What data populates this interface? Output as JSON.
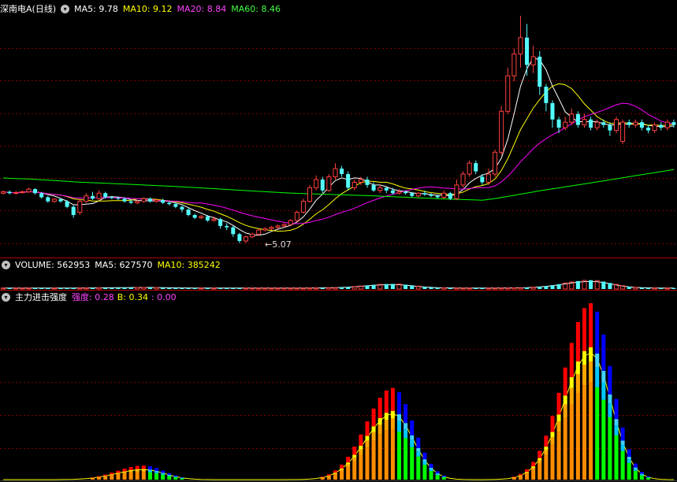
{
  "colors": {
    "up": "#ff4040",
    "down": "#54fcfc",
    "ma5": "#ffffff",
    "ma10": "#ffff00",
    "ma20": "#ff00ff",
    "ma60": "#00ff00",
    "grid": "#7a0000",
    "sep": "#b00000"
  },
  "price_header": {
    "title": "深南电A(日线)",
    "icon": "chevron-down-icon",
    "ma5": "MA5: 9.78",
    "ma10": "MA10: 9.12",
    "ma20": "MA20: 8.84",
    "ma60": "MA60: 8.46"
  },
  "low_marker": "←5.07",
  "volume_header": {
    "icon": "chevron-down-icon",
    "vol": "VOLUME: 562953",
    "ma5": "MA5: 627570",
    "ma10": "MA10: 385242"
  },
  "indicator_header": {
    "icon": "chevron-down-icon",
    "title": "主力进击强度",
    "qd": "强度: 0.28",
    "b": "B: 0.34",
    "z": ": 0.00"
  },
  "chart_data": [
    {
      "type": "candlestick",
      "title": "深南电A(日线)",
      "series": [
        {
          "name": "MA5",
          "value": 9.78
        },
        {
          "name": "MA10",
          "value": 9.12
        },
        {
          "name": "MA20",
          "value": 8.84
        },
        {
          "name": "MA60",
          "value": 8.46
        }
      ],
      "ylim": [
        4.6,
        13.4
      ],
      "min_marker": 5.07,
      "candles": [
        [
          6.9,
          6.95,
          6.85,
          7.0
        ],
        [
          6.95,
          6.9,
          6.85,
          7.0
        ],
        [
          6.9,
          6.92,
          6.85,
          6.98
        ],
        [
          6.92,
          6.95,
          6.88,
          7.0
        ],
        [
          6.95,
          7.05,
          6.9,
          7.1
        ],
        [
          7.05,
          6.9,
          6.85,
          7.08
        ],
        [
          6.9,
          6.75,
          6.7,
          6.95
        ],
        [
          6.75,
          6.6,
          6.55,
          6.8
        ],
        [
          6.6,
          6.68,
          6.55,
          6.72
        ],
        [
          6.68,
          6.6,
          6.55,
          6.7
        ],
        [
          6.6,
          6.4,
          6.35,
          6.65
        ],
        [
          6.4,
          6.1,
          6.0,
          6.45
        ],
        [
          6.2,
          6.6,
          6.1,
          6.7
        ],
        [
          6.6,
          6.8,
          6.55,
          6.9
        ],
        [
          6.8,
          6.7,
          6.65,
          6.95
        ],
        [
          6.7,
          6.9,
          6.65,
          7.0
        ],
        [
          6.9,
          6.75,
          6.7,
          6.95
        ],
        [
          6.75,
          6.72,
          6.68,
          6.8
        ],
        [
          6.72,
          6.7,
          6.65,
          6.78
        ],
        [
          6.7,
          6.6,
          6.55,
          6.75
        ],
        [
          6.6,
          6.55,
          6.5,
          6.65
        ],
        [
          6.55,
          6.6,
          6.5,
          6.65
        ],
        [
          6.6,
          6.7,
          6.55,
          6.75
        ],
        [
          6.7,
          6.6,
          6.55,
          6.75
        ],
        [
          6.6,
          6.65,
          6.55,
          6.7
        ],
        [
          6.65,
          6.55,
          6.5,
          6.7
        ],
        [
          6.55,
          6.5,
          6.45,
          6.6
        ],
        [
          6.5,
          6.4,
          6.35,
          6.55
        ],
        [
          6.4,
          6.3,
          6.2,
          6.45
        ],
        [
          6.3,
          6.1,
          6.05,
          6.35
        ],
        [
          6.1,
          6.0,
          5.95,
          6.15
        ],
        [
          6.0,
          6.05,
          5.95,
          6.1
        ],
        [
          6.05,
          5.9,
          5.85,
          6.1
        ],
        [
          5.9,
          5.95,
          5.85,
          6.05
        ],
        [
          5.95,
          5.7,
          5.6,
          6.0
        ],
        [
          5.7,
          5.65,
          5.55,
          5.8
        ],
        [
          5.65,
          5.4,
          5.3,
          5.7
        ],
        [
          5.4,
          5.15,
          5.07,
          5.45
        ],
        [
          5.15,
          5.3,
          5.07,
          5.35
        ],
        [
          5.3,
          5.4,
          5.25,
          5.45
        ],
        [
          5.4,
          5.55,
          5.35,
          5.6
        ],
        [
          5.55,
          5.6,
          5.5,
          5.65
        ],
        [
          5.6,
          5.65,
          5.55,
          5.7
        ],
        [
          5.65,
          5.7,
          5.6,
          5.75
        ],
        [
          5.7,
          5.75,
          5.65,
          5.8
        ],
        [
          5.75,
          5.9,
          5.7,
          5.95
        ],
        [
          5.9,
          6.2,
          5.85,
          6.25
        ],
        [
          6.2,
          6.6,
          6.15,
          6.7
        ],
        [
          6.6,
          7.1,
          6.55,
          7.2
        ],
        [
          7.1,
          7.4,
          7.0,
          7.55
        ],
        [
          7.4,
          7.0,
          6.9,
          7.5
        ],
        [
          7.0,
          7.5,
          6.95,
          7.6
        ],
        [
          7.5,
          7.8,
          7.4,
          8.0
        ],
        [
          7.8,
          7.6,
          7.5,
          7.9
        ],
        [
          7.6,
          7.1,
          7.0,
          7.7
        ],
        [
          7.1,
          7.3,
          7.0,
          7.4
        ],
        [
          7.3,
          7.4,
          7.2,
          7.5
        ],
        [
          7.4,
          7.2,
          7.1,
          7.5
        ],
        [
          7.2,
          7.0,
          6.95,
          7.3
        ],
        [
          7.0,
          7.1,
          6.9,
          7.2
        ],
        [
          7.1,
          7.0,
          6.9,
          7.15
        ],
        [
          7.0,
          6.9,
          6.85,
          7.1
        ],
        [
          6.9,
          6.95,
          6.85,
          7.05
        ],
        [
          6.95,
          6.9,
          6.85,
          7.0
        ],
        [
          6.9,
          6.8,
          6.75,
          6.95
        ],
        [
          6.8,
          6.9,
          6.75,
          6.95
        ],
        [
          6.9,
          6.85,
          6.8,
          7.0
        ],
        [
          6.85,
          6.8,
          6.75,
          6.9
        ],
        [
          6.8,
          6.75,
          6.7,
          6.85
        ],
        [
          6.75,
          6.9,
          6.7,
          7.0
        ],
        [
          6.9,
          6.7,
          6.65,
          6.95
        ],
        [
          6.7,
          7.2,
          6.65,
          7.4
        ],
        [
          7.2,
          7.6,
          7.1,
          7.7
        ],
        [
          7.6,
          8.0,
          7.5,
          8.1
        ],
        [
          8.0,
          7.7,
          7.6,
          8.1
        ],
        [
          7.5,
          7.3,
          7.2,
          7.6
        ],
        [
          7.3,
          7.6,
          7.2,
          7.8
        ],
        [
          7.6,
          8.4,
          7.5,
          8.5
        ],
        [
          8.4,
          9.9,
          8.3,
          10.1
        ],
        [
          9.9,
          11.2,
          9.8,
          11.5
        ],
        [
          11.2,
          12.0,
          11.0,
          12.2
        ],
        [
          12.0,
          12.6,
          11.5,
          13.4
        ],
        [
          12.6,
          11.6,
          11.2,
          13.1
        ],
        [
          11.6,
          11.9,
          11.3,
          12.3
        ],
        [
          11.9,
          10.8,
          10.5,
          12.1
        ],
        [
          10.8,
          10.2,
          9.9,
          10.9
        ],
        [
          10.2,
          9.6,
          9.3,
          10.3
        ],
        [
          9.6,
          9.3,
          9.1,
          9.7
        ],
        [
          9.3,
          9.5,
          9.2,
          9.7
        ],
        [
          9.5,
          9.8,
          9.4,
          10.0
        ],
        [
          9.8,
          9.4,
          9.3,
          9.9
        ],
        [
          9.4,
          9.6,
          9.3,
          9.8
        ],
        [
          9.6,
          9.3,
          9.2,
          9.7
        ],
        [
          9.3,
          9.5,
          9.2,
          9.6
        ],
        [
          9.5,
          9.4,
          9.3,
          9.6
        ],
        [
          9.4,
          9.2,
          9.0,
          9.5
        ],
        [
          9.2,
          9.6,
          9.1,
          9.7
        ],
        [
          8.8,
          9.5,
          8.7,
          9.6
        ],
        [
          9.5,
          9.4,
          9.3,
          9.6
        ],
        [
          9.4,
          9.5,
          9.3,
          9.6
        ],
        [
          9.5,
          9.3,
          9.2,
          9.6
        ],
        [
          9.3,
          9.2,
          9.1,
          9.4
        ],
        [
          9.2,
          9.4,
          9.1,
          9.5
        ],
        [
          9.4,
          9.3,
          9.2,
          9.5
        ],
        [
          9.3,
          9.5,
          9.2,
          9.6
        ],
        [
          9.5,
          9.4,
          9.3,
          9.6
        ]
      ]
    },
    {
      "type": "bar",
      "title": "VOLUME",
      "series": [
        {
          "name": "VOLUME",
          "value": 562953
        },
        {
          "name": "MA5",
          "value": 627570
        },
        {
          "name": "MA10",
          "value": 385242
        }
      ]
    },
    {
      "type": "bar",
      "title": "主力进击强度",
      "series": [
        {
          "name": "强度",
          "value": 0.28
        },
        {
          "name": "B",
          "value": 0.34
        },
        {
          "name": "",
          "value": 0.0
        }
      ],
      "ylim": [
        0,
        1
      ],
      "peaks": [
        {
          "center": 22,
          "height": 0.08
        },
        {
          "center": 61,
          "height": 0.52
        },
        {
          "center": 92,
          "height": 1.0
        }
      ]
    }
  ]
}
